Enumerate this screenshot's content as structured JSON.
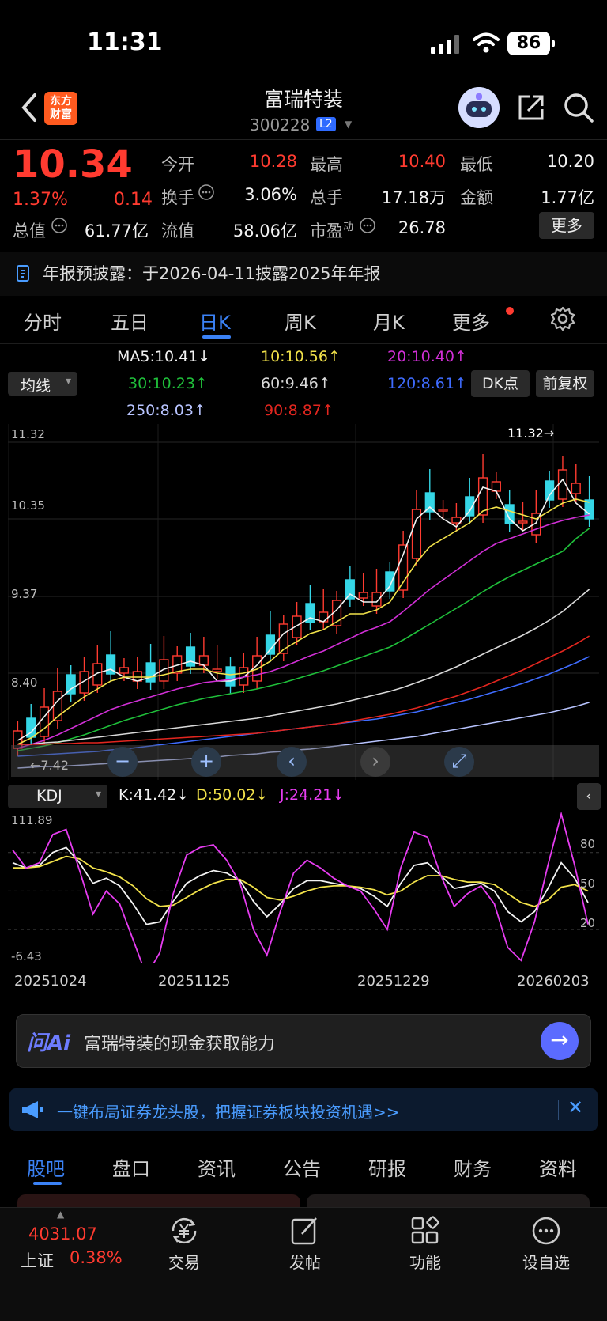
{
  "status": {
    "time": "11:31",
    "battery": "86"
  },
  "header": {
    "name": "富瑞特装",
    "code": "300228",
    "l2": "L2",
    "logo_line1": "东方",
    "logo_line2": "财富"
  },
  "quote": {
    "price": "10.34",
    "pct": "1.37%",
    "change": "0.14",
    "rows": [
      [
        {
          "l": "今开",
          "v": "10.28",
          "c": "red"
        },
        {
          "l": "最高",
          "v": "10.40",
          "c": "red"
        },
        {
          "l": "最低",
          "v": "10.20",
          "c": "white"
        }
      ],
      [
        {
          "l": "换手",
          "v": "3.06%",
          "c": "white"
        },
        {
          "l": "总手",
          "v": "17.18万",
          "c": "white"
        },
        {
          "l": "金额",
          "v": "1.77亿",
          "c": "white"
        }
      ]
    ],
    "row3": {
      "zz_l": "总值",
      "zz_v": "61.77亿",
      "lz_l": "流值",
      "lz_v": "58.06亿",
      "sy_l": "市盈",
      "sy_sup": "动",
      "sy_v": "26.78"
    },
    "more": "更多"
  },
  "notice": {
    "text": "年报预披露：于2026-04-11披露2025年年报"
  },
  "ktabs": [
    "分时",
    "五日",
    "日K",
    "周K",
    "月K",
    "更多"
  ],
  "ma": {
    "junxian": "均线",
    "dk": "DK点",
    "fq": "前复权",
    "items": [
      {
        "t": "MA5:10.41↓",
        "color": "#f2f2f2"
      },
      {
        "t": "10:10.56↑",
        "color": "#f2e24a"
      },
      {
        "t": "20:10.40↑",
        "color": "#d12fd6"
      },
      {
        "t": "30:10.23↑",
        "color": "#1fbf3a"
      },
      {
        "t": "60:9.46↑",
        "color": "#d9d9d9"
      },
      {
        "t": "120:8.61↑",
        "color": "#3f6cff"
      },
      {
        "t": "250:8.03↑",
        "color": "#b8c4ff"
      },
      {
        "t": "90:8.87↑",
        "color": "#e3261f"
      }
    ]
  },
  "kchart": {
    "ylabels": [
      "11.32",
      "10.35",
      "9.37",
      "8.40"
    ],
    "max_label": "11.32",
    "min_label": "7.42"
  },
  "kdj": {
    "selector": "KDJ",
    "k": "K:41.42↓",
    "d": "D:50.02↓",
    "j": "J:24.21↓",
    "ymax": "111.89",
    "ymin": "-6.43",
    "levels": [
      "80",
      "50",
      "20"
    ]
  },
  "dates": [
    "20251024",
    "20251125",
    "20251229",
    "20260203"
  ],
  "chart_data": [
    {
      "type": "candlestick",
      "title": "",
      "yticks": [
        11.32,
        10.35,
        9.37,
        8.4
      ],
      "series": [
        {
          "name": "MA5",
          "values": [
            7.55,
            7.65,
            7.85,
            8.05,
            8.2,
            8.3,
            8.4,
            8.45,
            8.35,
            8.3,
            8.35,
            8.45,
            8.5,
            8.55,
            8.5,
            8.3,
            8.3,
            8.35,
            8.5,
            8.7,
            8.9,
            9.0,
            9.1,
            9.05,
            9.2,
            9.4,
            9.3,
            9.3,
            9.5,
            9.9,
            10.35,
            10.5,
            10.35,
            10.25,
            10.45,
            10.75,
            10.7,
            10.35,
            10.2,
            10.3,
            10.65,
            10.85,
            10.55,
            10.41
          ]
        },
        {
          "name": "10",
          "values": [
            7.5,
            7.58,
            7.7,
            7.85,
            7.98,
            8.1,
            8.2,
            8.3,
            8.35,
            8.35,
            8.35,
            8.38,
            8.42,
            8.45,
            8.45,
            8.4,
            8.38,
            8.4,
            8.45,
            8.55,
            8.7,
            8.8,
            8.9,
            8.95,
            9.05,
            9.15,
            9.15,
            9.2,
            9.3,
            9.55,
            9.8,
            10.0,
            10.1,
            10.2,
            10.3,
            10.45,
            10.5,
            10.45,
            10.4,
            10.35,
            10.45,
            10.55,
            10.6,
            10.56
          ]
        },
        {
          "name": "20",
          "values": [
            7.45,
            7.5,
            7.55,
            7.62,
            7.7,
            7.78,
            7.86,
            7.94,
            8.0,
            8.05,
            8.1,
            8.15,
            8.2,
            8.24,
            8.28,
            8.3,
            8.32,
            8.35,
            8.38,
            8.42,
            8.48,
            8.55,
            8.62,
            8.68,
            8.76,
            8.84,
            8.92,
            8.98,
            9.05,
            9.18,
            9.32,
            9.46,
            9.58,
            9.7,
            9.82,
            9.94,
            10.04,
            10.1,
            10.16,
            10.22,
            10.28,
            10.33,
            10.37,
            10.4
          ]
        },
        {
          "name": "30",
          "values": [
            7.42,
            7.45,
            7.48,
            7.52,
            7.57,
            7.62,
            7.68,
            7.74,
            7.8,
            7.85,
            7.9,
            7.95,
            8.0,
            8.04,
            8.08,
            8.11,
            8.14,
            8.17,
            8.2,
            8.24,
            8.28,
            8.33,
            8.38,
            8.43,
            8.49,
            8.55,
            8.61,
            8.67,
            8.73,
            8.82,
            8.92,
            9.02,
            9.12,
            9.22,
            9.32,
            9.43,
            9.53,
            9.62,
            9.7,
            9.78,
            9.86,
            9.94,
            10.1,
            10.23
          ]
        },
        {
          "name": "60",
          "values": [
            7.5,
            7.5,
            7.52,
            7.53,
            7.55,
            7.57,
            7.59,
            7.61,
            7.63,
            7.65,
            7.67,
            7.69,
            7.71,
            7.73,
            7.75,
            7.77,
            7.79,
            7.81,
            7.83,
            7.86,
            7.89,
            7.92,
            7.95,
            7.98,
            8.01,
            8.05,
            8.09,
            8.13,
            8.17,
            8.22,
            8.28,
            8.34,
            8.41,
            8.48,
            8.56,
            8.64,
            8.72,
            8.8,
            8.88,
            8.97,
            9.07,
            9.18,
            9.32,
            9.46
          ]
        },
        {
          "name": "120",
          "values": [
            7.35,
            7.36,
            7.37,
            7.38,
            7.39,
            7.4,
            7.41,
            7.43,
            7.44,
            7.46,
            7.48,
            7.5,
            7.52,
            7.54,
            7.56,
            7.58,
            7.6,
            7.62,
            7.64,
            7.66,
            7.68,
            7.7,
            7.72,
            7.74,
            7.76,
            7.78,
            7.8,
            7.82,
            7.85,
            7.88,
            7.91,
            7.95,
            7.99,
            8.03,
            8.07,
            8.12,
            8.17,
            8.22,
            8.27,
            8.33,
            8.39,
            8.46,
            8.53,
            8.61
          ]
        },
        {
          "name": "250",
          "values": [
            7.2,
            7.21,
            7.22,
            7.22,
            7.23,
            7.24,
            7.25,
            7.26,
            7.27,
            7.28,
            7.29,
            7.3,
            7.31,
            7.32,
            7.33,
            7.34,
            7.36,
            7.37,
            7.38,
            7.4,
            7.41,
            7.43,
            7.44,
            7.46,
            7.48,
            7.5,
            7.52,
            7.54,
            7.56,
            7.58,
            7.6,
            7.63,
            7.66,
            7.69,
            7.72,
            7.75,
            7.78,
            7.81,
            7.84,
            7.87,
            7.9,
            7.94,
            7.98,
            8.03
          ]
        },
        {
          "name": "90",
          "values": [
            7.5,
            7.5,
            7.5,
            7.51,
            7.51,
            7.52,
            7.52,
            7.53,
            7.54,
            7.55,
            7.56,
            7.57,
            7.58,
            7.59,
            7.6,
            7.61,
            7.62,
            7.63,
            7.64,
            7.66,
            7.68,
            7.7,
            7.72,
            7.74,
            7.76,
            7.79,
            7.82,
            7.85,
            7.88,
            7.92,
            7.96,
            8.01,
            8.06,
            8.11,
            8.17,
            8.23,
            8.3,
            8.37,
            8.44,
            8.52,
            8.6,
            8.68,
            8.77,
            8.87
          ]
        }
      ]
    },
    {
      "type": "line",
      "title": "",
      "ylim": [
        -6.43,
        111.89
      ],
      "series": [
        {
          "name": "K",
          "values": [
            72,
            68,
            70,
            80,
            84,
            72,
            56,
            60,
            54,
            40,
            24,
            26,
            42,
            56,
            62,
            66,
            64,
            58,
            42,
            30,
            40,
            52,
            58,
            58,
            56,
            54,
            52,
            46,
            38,
            56,
            70,
            72,
            62,
            52,
            54,
            56,
            50,
            34,
            26,
            34,
            52,
            72,
            60,
            41
          ]
        },
        {
          "name": "D",
          "values": [
            68,
            68,
            69,
            73,
            77,
            75,
            68,
            65,
            61,
            54,
            44,
            38,
            39,
            45,
            51,
            56,
            59,
            59,
            53,
            45,
            43,
            46,
            50,
            53,
            54,
            54,
            53,
            51,
            47,
            50,
            57,
            62,
            62,
            59,
            57,
            57,
            55,
            48,
            41,
            38,
            43,
            53,
            55,
            50
          ]
        },
        {
          "name": "J",
          "values": [
            82,
            68,
            72,
            94,
            98,
            66,
            32,
            50,
            40,
            12,
            -16,
            2,
            48,
            78,
            84,
            86,
            74,
            56,
            20,
            0,
            34,
            64,
            74,
            68,
            60,
            54,
            50,
            36,
            20,
            68,
            96,
            92,
            62,
            38,
            48,
            54,
            40,
            6,
            -4,
            26,
            70,
            110,
            70,
            24
          ]
        }
      ]
    }
  ],
  "zoom": {
    "minus": "−",
    "plus": "+",
    "left": "‹",
    "right": "›",
    "fit": "⤢"
  },
  "ai": {
    "logo": "问Ai",
    "text": "富瑞特装的现金获取能力"
  },
  "banner": {
    "text": "一键布局证券龙头股，把握证券板块投资机遇>>",
    "close": "✕"
  },
  "btabs": [
    "股吧",
    "盘口",
    "资讯",
    "公告",
    "研报",
    "财务",
    "资料"
  ],
  "footer": {
    "index_val": "4031.07",
    "index_name": "上证",
    "index_pct": "0.38%",
    "trade": "交易",
    "post": "发帖",
    "func": "功能",
    "fav": "设自选"
  }
}
